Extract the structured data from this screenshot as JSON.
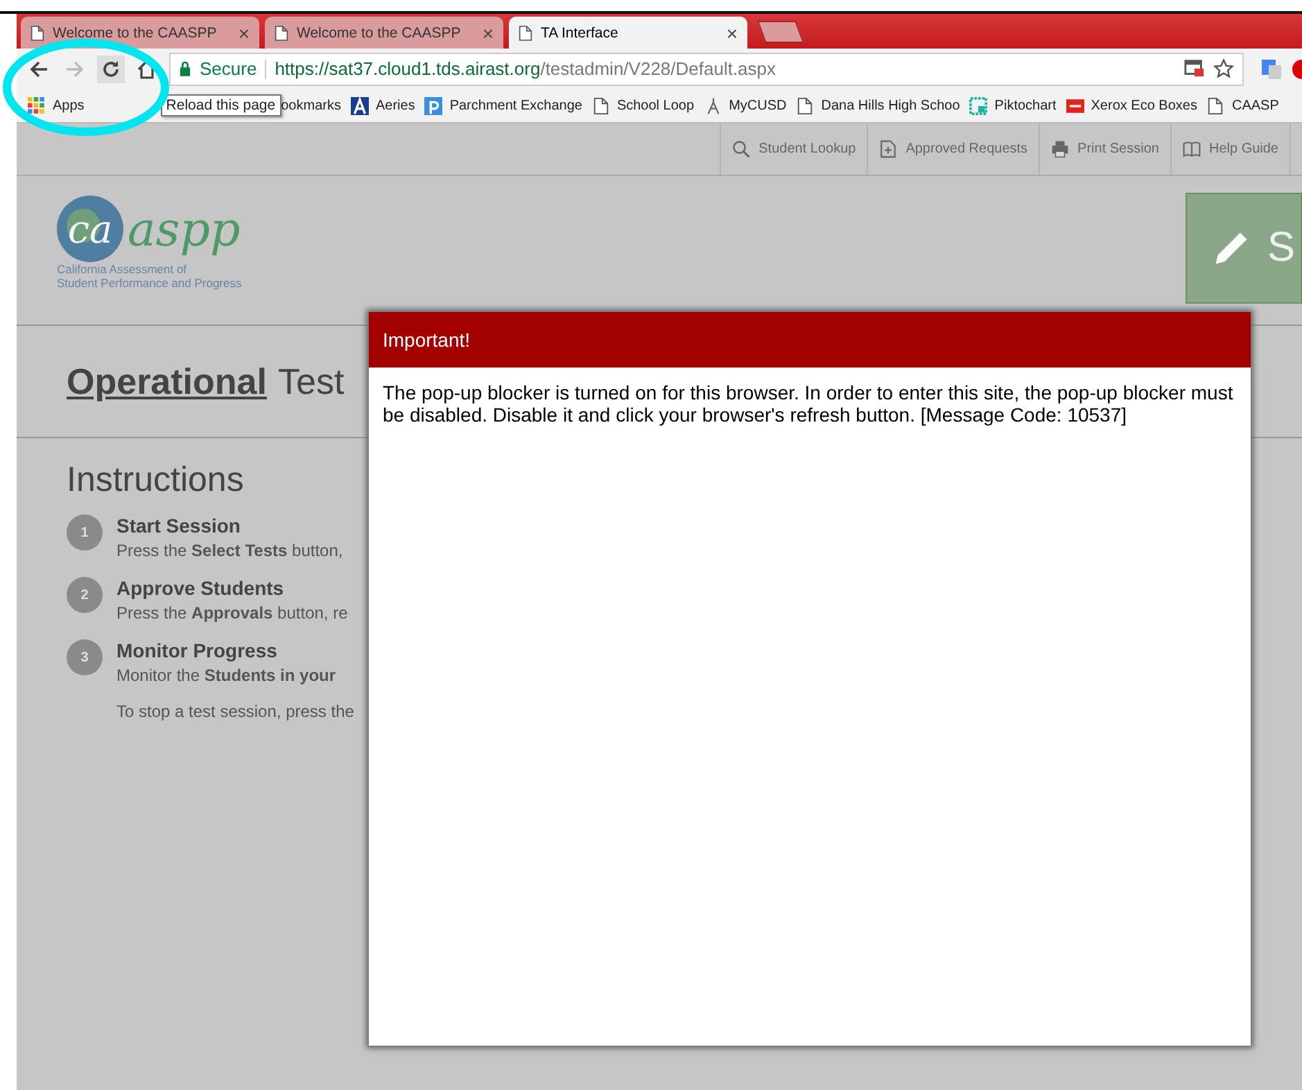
{
  "browser": {
    "tabs": [
      {
        "title": "Welcome to the CAASPP",
        "close": "×",
        "selected": false
      },
      {
        "title": "Welcome to the CAASPP",
        "close": "×",
        "selected": false
      },
      {
        "title": "TA Interface",
        "close": "×",
        "selected": true
      }
    ],
    "address": {
      "secure_label": "Secure",
      "url_host": "https://sat37.cloud1.tds.airast.org",
      "url_path": "/testadmin/V228/Default.aspx"
    },
    "tooltip": "Reload this page",
    "bookmarks": [
      {
        "label": "Apps",
        "kind": "apps"
      },
      {
        "label": "ookmarks",
        "kind": "plain"
      },
      {
        "label": "Aeries",
        "kind": "aeries"
      },
      {
        "label": "Parchment Exchange",
        "kind": "parchment"
      },
      {
        "label": "School Loop",
        "kind": "page"
      },
      {
        "label": "MyCUSD",
        "kind": "antenna"
      },
      {
        "label": "Dana Hills High Schoo",
        "kind": "page"
      },
      {
        "label": "Piktochart",
        "kind": "piktochart"
      },
      {
        "label": "Xerox Eco Boxes",
        "kind": "xerox"
      },
      {
        "label": "CAASP",
        "kind": "page"
      }
    ]
  },
  "toolbar": [
    {
      "label": "Student Lookup",
      "kind": "search"
    },
    {
      "label": "Approved Requests",
      "kind": "document"
    },
    {
      "label": "Print Session",
      "kind": "printer"
    },
    {
      "label": "Help Guide",
      "kind": "book"
    }
  ],
  "logo": {
    "mark": "ca",
    "wordmark": "aspp",
    "subtitle": [
      "California Assessment of",
      "Student Performance and Progress"
    ]
  },
  "start_button": "S",
  "heading": {
    "strong": "Operational",
    "rest": "Test"
  },
  "instructions": {
    "title": "Instructions",
    "steps": [
      {
        "number": "1",
        "title": "Start Session",
        "text": "Press the **Select Tests** button,"
      },
      {
        "number": "2",
        "title": "Approve Students",
        "text": "Press the **Approvals** button, re"
      },
      {
        "number": "3",
        "title": "Monitor Progress",
        "text": "Monitor the **Students in your**"
      }
    ],
    "note": "To stop a test session, press the"
  },
  "dialog": {
    "title": "Important!",
    "message": "The pop-up blocker is turned on for this browser. In order to enter this site, the pop-up blocker must be disabled. Disable it and click your browser's refresh button. [Message Code: 10537]"
  }
}
